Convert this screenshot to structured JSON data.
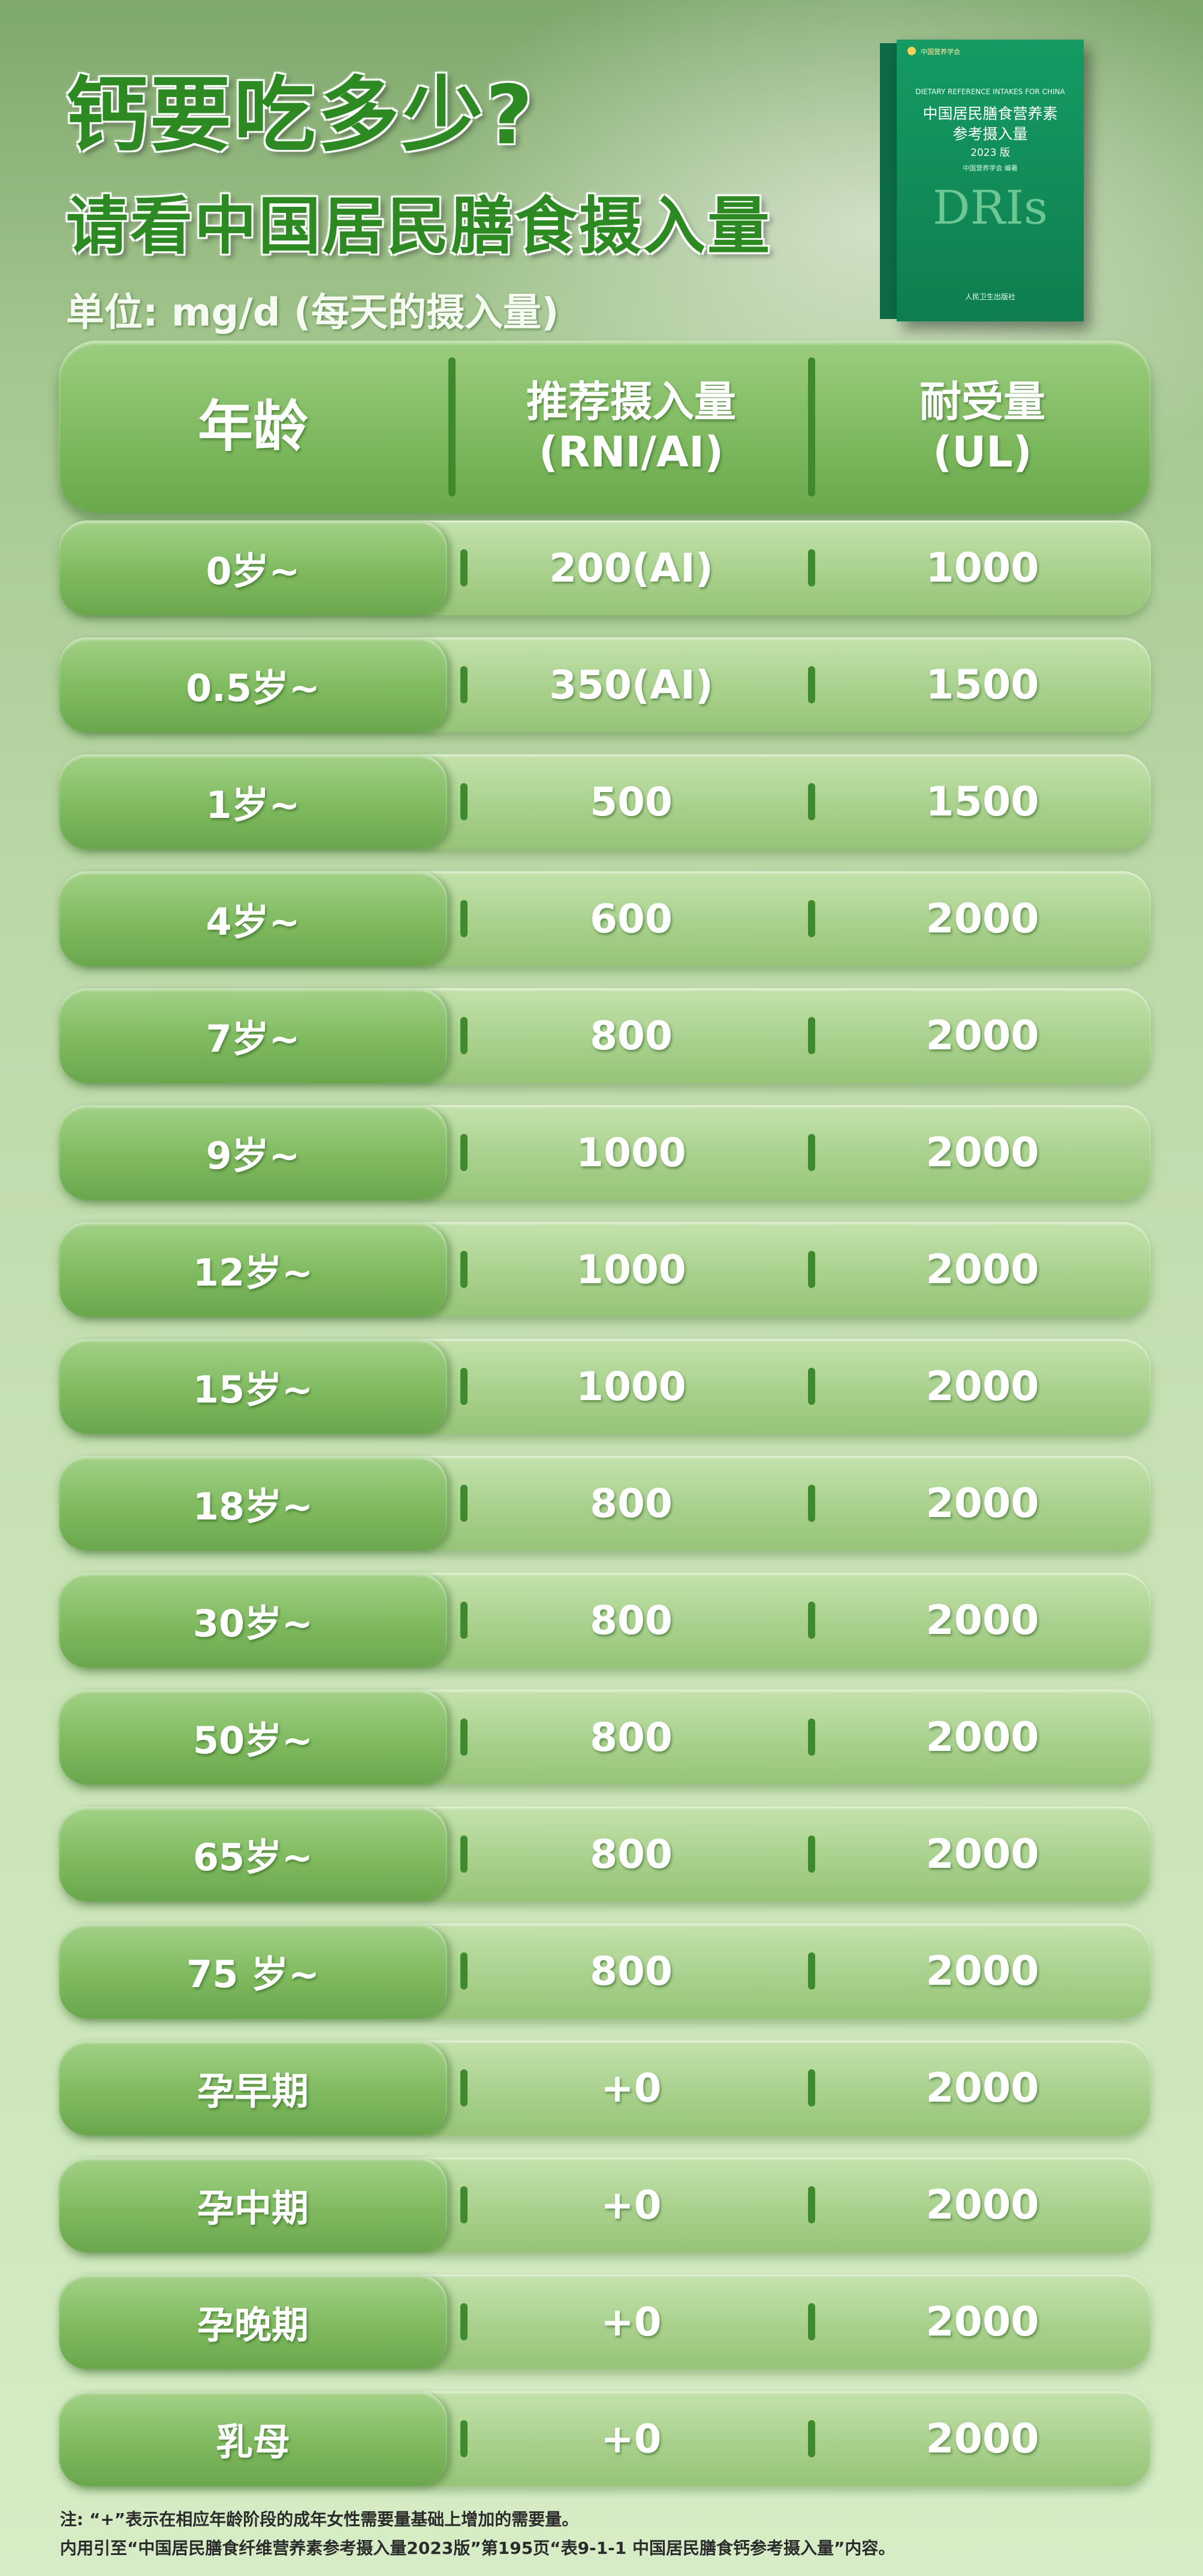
{
  "title_line1": "钙要吃多少?",
  "title_line2": "请看中国居民膳食摄入量",
  "unit": "单位: mg/d (每天的摄入量)",
  "book": {
    "publisher_top": "中国营养学会",
    "english_title": "DIETARY REFERENCE INTAKES FOR CHINA",
    "cn_title_1": "中国居民膳食营养素",
    "cn_title_2": "参考摄入量",
    "edition": "2023 版",
    "editor": "中国营养学会 编著",
    "logo_text": "DRIs",
    "press": "人民卫生出版社"
  },
  "table": {
    "header": {
      "age": "年龄",
      "rni_line1": "推荐摄入量",
      "rni_line2": "(RNI/AI)",
      "ul_line1": "耐受量",
      "ul_line2": "(UL)"
    },
    "rows": [
      {
        "age": "0岁~",
        "rni": "200(AI)",
        "ul": "1000"
      },
      {
        "age": "0.5岁~",
        "rni": "350(AI)",
        "ul": "1500"
      },
      {
        "age": "1岁~",
        "rni": "500",
        "ul": "1500"
      },
      {
        "age": "4岁~",
        "rni": "600",
        "ul": "2000"
      },
      {
        "age": "7岁~",
        "rni": "800",
        "ul": "2000"
      },
      {
        "age": "9岁~",
        "rni": "1000",
        "ul": "2000"
      },
      {
        "age": "12岁~",
        "rni": "1000",
        "ul": "2000"
      },
      {
        "age": "15岁~",
        "rni": "1000",
        "ul": "2000"
      },
      {
        "age": "18岁~",
        "rni": "800",
        "ul": "2000"
      },
      {
        "age": "30岁~",
        "rni": "800",
        "ul": "2000"
      },
      {
        "age": "50岁~",
        "rni": "800",
        "ul": "2000"
      },
      {
        "age": "65岁~",
        "rni": "800",
        "ul": "2000"
      },
      {
        "age": "75 岁~",
        "rni": "800",
        "ul": "2000"
      },
      {
        "age": "孕早期",
        "rni": "+0",
        "ul": "2000"
      },
      {
        "age": "孕中期",
        "rni": "+0",
        "ul": "2000"
      },
      {
        "age": "孕晚期",
        "rni": "+0",
        "ul": "2000"
      },
      {
        "age": "乳母",
        "rni": "+0",
        "ul": "2000"
      }
    ]
  },
  "notes": [
    "注: “+”表示在相应年龄阶段的成年女性需要量基础上增加的需要量。",
    "内用引至“中国居民膳食纤维营养素参考摄入量2023版”第195页“表9-1-1 中国居民膳食钙参考摄入量”内容。"
  ]
}
